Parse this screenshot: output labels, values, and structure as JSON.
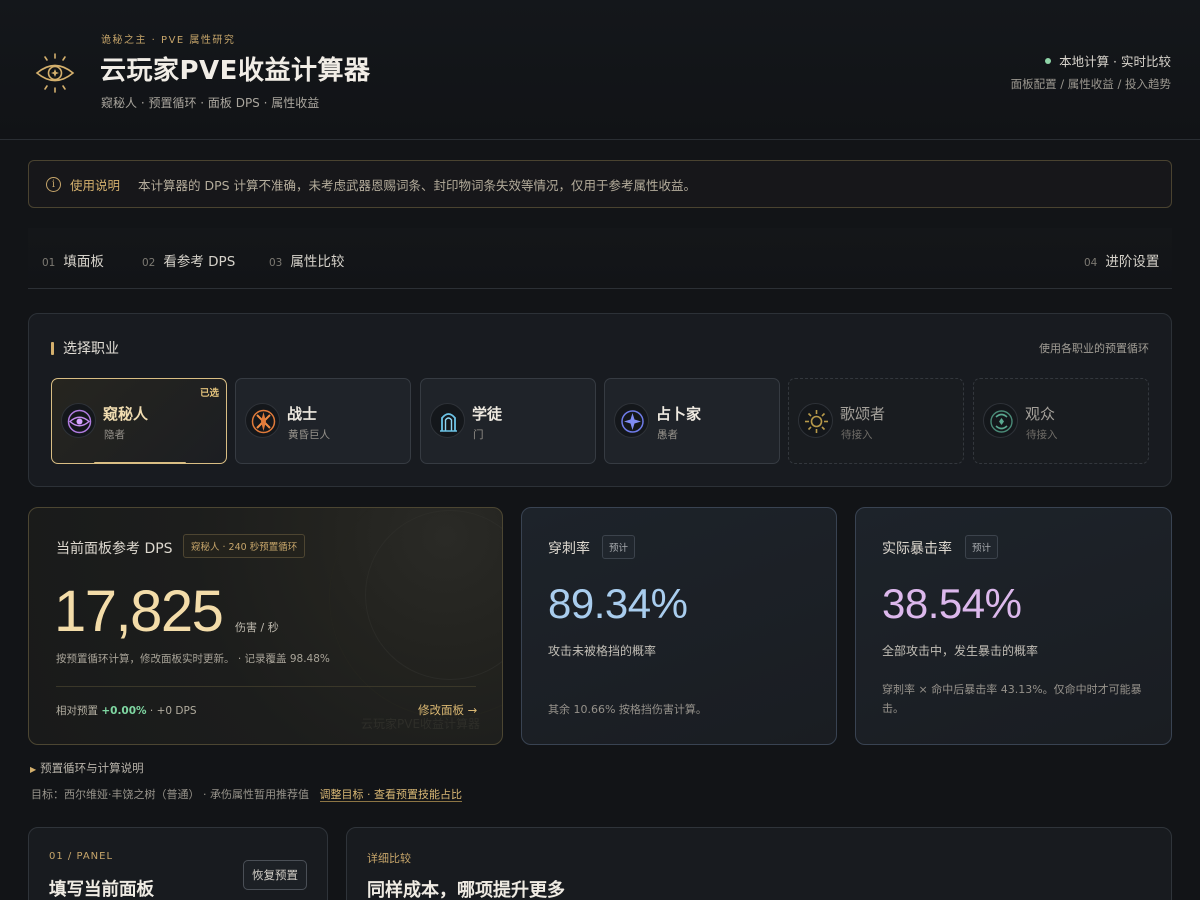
{
  "header": {
    "kicker": "诡秘之主 · PVE 属性研究",
    "title": "云玩家PVE收益计算器",
    "subtitle": "窥秘人 · 预置循环 · 面板 DPS · 属性收益",
    "status": "本地计算 · 实时比较",
    "links": "面板配置 / 属性收益 / 投入趋势"
  },
  "notice": {
    "title": "使用说明",
    "text": "本计算器的 DPS 计算不准确，未考虑武器恩赐词条、封印物词条失效等情况，仅用于参考属性收益。"
  },
  "tabs": [
    {
      "num": "01",
      "label": "填面板"
    },
    {
      "num": "02",
      "label": "看参考 DPS"
    },
    {
      "num": "03",
      "label": "属性比较"
    },
    {
      "num": "04",
      "label": "进阶设置"
    }
  ],
  "class_select": {
    "title": "选择职业",
    "hint": "使用各职业的预置循环",
    "selected_badge": "已选",
    "classes": [
      {
        "name": "窥秘人",
        "sub": "隐者",
        "icon": "seer-eye-icon",
        "color": "#b07be0"
      },
      {
        "name": "战士",
        "sub": "黄昏巨人",
        "icon": "warrior-icon",
        "color": "#e07a3a"
      },
      {
        "name": "学徒",
        "sub": "门",
        "icon": "apprentice-door-icon",
        "color": "#6cc3e6"
      },
      {
        "name": "占卜家",
        "sub": "愚者",
        "icon": "diviner-icon",
        "color": "#6e7be8"
      },
      {
        "name": "歌颂者",
        "sub": "待接入",
        "icon": "sun-icon",
        "color": "#b89a4a"
      },
      {
        "name": "观众",
        "sub": "待接入",
        "icon": "audience-icon",
        "color": "#5aa890"
      }
    ]
  },
  "dps": {
    "label": "当前面板参考 DPS",
    "chip": "窥秘人 · 240 秒预置循环",
    "value": "17,825",
    "unit": "伤害 / 秒",
    "desc": "按预置循环计算，修改面板实时更新。 · 记录覆盖 98.48%",
    "foot_prefix": "相对预置 ",
    "foot_delta": "+0.00%",
    "foot_suffix": " · +0 DPS",
    "link": "修改面板 →",
    "watermark": "云玩家PVE收益计算器"
  },
  "pierce": {
    "label": "穿刺率",
    "chip": "预计",
    "value": "89.34%",
    "desc": "攻击未被格挡的概率",
    "note": "其余 10.66% 按格挡伤害计算。",
    "color": "#a9cdee"
  },
  "crit": {
    "label": "实际暴击率",
    "chip": "预计",
    "value": "38.54%",
    "desc": "全部攻击中，发生暴击的概率",
    "note": "穿刺率 × 命中后暴击率 43.13%。仅命中时才可能暴击。",
    "color": "#dcb8ec"
  },
  "loop": {
    "toggle": "预置循环与计算说明",
    "target": "目标：西尔维娅·丰饶之树（普通） · 承伤属性暂用推荐值",
    "link1": "调整目标",
    "sep": " · ",
    "link2": "查看预置技能占比"
  },
  "panel": {
    "kicker": "01 / PANEL",
    "title": "填写当前面板",
    "restore": "恢复预置"
  },
  "compare": {
    "kicker": "详细比较",
    "title": "同样成本，哪项提升更多"
  }
}
